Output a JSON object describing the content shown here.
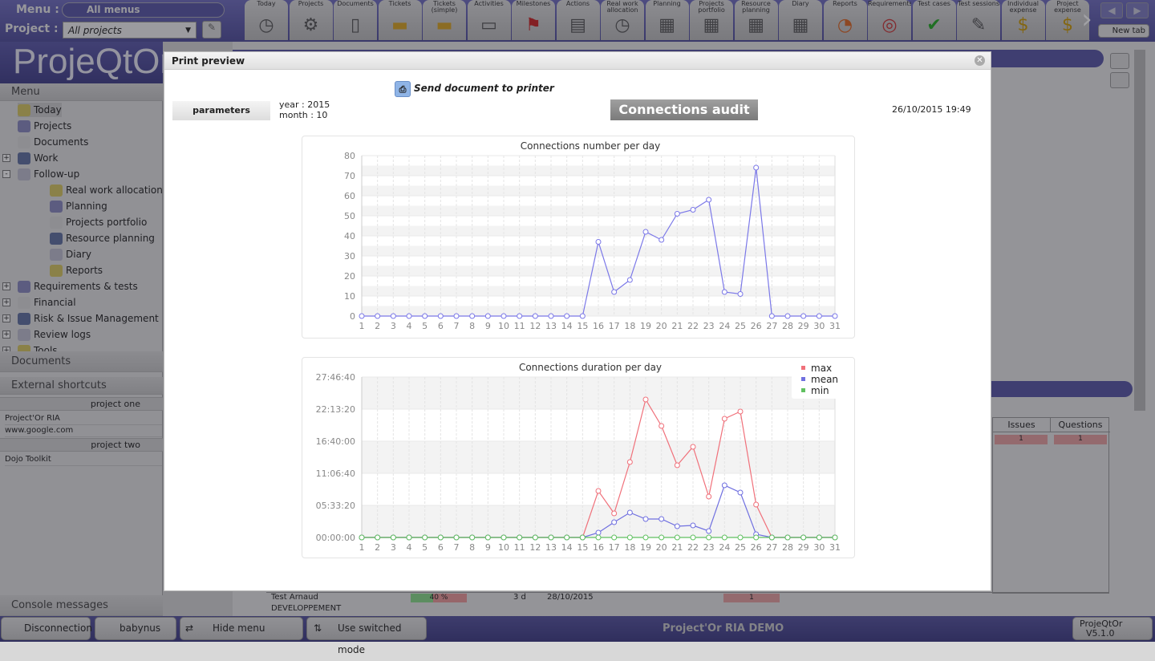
{
  "header": {
    "menu_label": "Menu :",
    "menu_value": "All menus",
    "project_label": "Project :",
    "project_value": "All projects",
    "logo": "ProjeQtOr",
    "toolbar": [
      {
        "label": "Today",
        "icon": "clock-icon"
      },
      {
        "label": "Projects",
        "icon": "gear-icon"
      },
      {
        "label": "Documents",
        "icon": "document-icon"
      },
      {
        "label": "Tickets",
        "icon": "ticket-icon"
      },
      {
        "label": "Tickets (simple)",
        "icon": "ticket-simple-icon"
      },
      {
        "label": "Activities",
        "icon": "computer-icon"
      },
      {
        "label": "Milestones",
        "icon": "flag-icon"
      },
      {
        "label": "Actions",
        "icon": "clapper-icon"
      },
      {
        "label": "Real work allocation",
        "icon": "work-allocation-icon"
      },
      {
        "label": "Planning",
        "icon": "gantt-icon"
      },
      {
        "label": "Projects portfolio",
        "icon": "portfolio-icon"
      },
      {
        "label": "Resource planning",
        "icon": "resource-planning-icon"
      },
      {
        "label": "Diary",
        "icon": "diary-icon"
      },
      {
        "label": "Reports",
        "icon": "reports-icon"
      },
      {
        "label": "Requirements",
        "icon": "target-icon"
      },
      {
        "label": "Test cases",
        "icon": "check-icon"
      },
      {
        "label": "Test sessions",
        "icon": "test-session-icon"
      },
      {
        "label": "Individual expense",
        "icon": "money-bag-icon"
      },
      {
        "label": "Project expense",
        "icon": "project-expense-icon"
      }
    ],
    "new_tab": "New tab"
  },
  "sidebar": {
    "menu_title": "Menu",
    "items": [
      {
        "label": "Today",
        "level": 0
      },
      {
        "label": "Projects",
        "level": 0
      },
      {
        "label": "Documents",
        "level": 0
      },
      {
        "label": "Work",
        "level": 0,
        "toggle": "+"
      },
      {
        "label": "Follow-up",
        "level": 0,
        "toggle": "-"
      },
      {
        "label": "Real work allocation",
        "level": 1
      },
      {
        "label": "Planning",
        "level": 1
      },
      {
        "label": "Projects portfolio",
        "level": 1
      },
      {
        "label": "Resource planning",
        "level": 1
      },
      {
        "label": "Diary",
        "level": 1
      },
      {
        "label": "Reports",
        "level": 1
      },
      {
        "label": "Requirements & tests",
        "level": 0,
        "toggle": "+"
      },
      {
        "label": "Financial",
        "level": 0,
        "toggle": "+"
      },
      {
        "label": "Risk & Issue Management",
        "level": 0,
        "toggle": "+"
      },
      {
        "label": "Review logs",
        "level": 0,
        "toggle": "+"
      },
      {
        "label": "Tools",
        "level": 0,
        "toggle": "+"
      }
    ],
    "documents_title": "Documents",
    "shortcuts_title": "External shortcuts",
    "shortcuts": [
      {
        "group": "project one",
        "links": [
          "Project'Or RIA",
          "www.google.com"
        ]
      },
      {
        "group": "project two",
        "links": [
          "Dojo Toolkit"
        ]
      }
    ],
    "console_title": "Console messages"
  },
  "main": {
    "table_headers": [
      "Issues",
      "Questions"
    ],
    "row_values": [
      "1",
      "1"
    ],
    "bottom_row": {
      "name": "Test Arnaud",
      "progress": "40 %",
      "duration": "3 d",
      "date": "28/10/2015",
      "count": "1"
    },
    "bottom_row2": "DEVELOPPEMENT"
  },
  "footer": {
    "disconnect": "Disconnection",
    "user": "babynus",
    "hide_menu": "Hide menu",
    "switched": "Use switched mode",
    "app_name": "Project'Or RIA DEMO",
    "version_name": "ProjeQtOr",
    "version": "V5.1.0"
  },
  "modal": {
    "title": "Print preview",
    "print_label": "Send document to printer",
    "params_button": "parameters",
    "param_year": "year : 2015",
    "param_month": "month : 10",
    "report_title": "Connections audit",
    "datetime": "26/10/2015 19:49"
  },
  "colors": {
    "max": "#f0707a",
    "mean": "#7070e0",
    "min": "#60c060",
    "count": "#7b78e8"
  },
  "chart_data": [
    {
      "type": "line",
      "title": "Connections number per day",
      "x": [
        1,
        2,
        3,
        4,
        5,
        6,
        7,
        8,
        9,
        10,
        11,
        12,
        13,
        14,
        15,
        16,
        17,
        18,
        19,
        20,
        21,
        22,
        23,
        24,
        25,
        26,
        27,
        28,
        29,
        30,
        31
      ],
      "ylim": [
        0,
        80
      ],
      "yticks": [
        0,
        10,
        20,
        30,
        40,
        50,
        60,
        70,
        80
      ],
      "grid": true,
      "series": [
        {
          "values": [
            0,
            0,
            0,
            0,
            0,
            0,
            0,
            0,
            0,
            0,
            0,
            0,
            0,
            0,
            0,
            37,
            12,
            18,
            42,
            38,
            51,
            53,
            58,
            12,
            11,
            74,
            0,
            0,
            0,
            0,
            0
          ]
        }
      ]
    },
    {
      "type": "line",
      "title": "Connections duration per day",
      "x": [
        1,
        2,
        3,
        4,
        5,
        6,
        7,
        8,
        9,
        10,
        11,
        12,
        13,
        14,
        15,
        16,
        17,
        18,
        19,
        20,
        21,
        22,
        23,
        24,
        25,
        26,
        27,
        28,
        29,
        30,
        31
      ],
      "ylim": [
        "00:00:00",
        "27:46:40"
      ],
      "yticks": [
        "00:00:00",
        "05:33:20",
        "11:06:40",
        "16:40:00",
        "22:13:20",
        "27:46:40"
      ],
      "grid": true,
      "legend": "top-right",
      "series": [
        {
          "name": "max",
          "values": [
            "00:00:00",
            "00:00:00",
            "00:00:00",
            "00:00:00",
            "00:00:00",
            "00:00:00",
            "00:00:00",
            "00:00:00",
            "00:00:00",
            "00:00:00",
            "00:00:00",
            "00:00:00",
            "00:00:00",
            "00:00:00",
            "00:00:00",
            "08:03:20",
            "04:10:00",
            "13:03:20",
            "23:53:20",
            "19:18:20",
            "12:30:00",
            "15:41:40",
            "07:05:00",
            "20:33:20",
            "21:48:20",
            "05:41:40",
            "00:00:00",
            "00:00:00",
            "00:00:00",
            "00:00:00",
            "00:00:00"
          ]
        },
        {
          "name": "mean",
          "values": [
            "00:00:00",
            "00:00:00",
            "00:00:00",
            "00:00:00",
            "00:00:00",
            "00:00:00",
            "00:00:00",
            "00:00:00",
            "00:00:00",
            "00:00:00",
            "00:00:00",
            "00:00:00",
            "00:00:00",
            "00:00:00",
            "00:00:00",
            "00:50:00",
            "02:38:20",
            "04:18:20",
            "03:11:40",
            "03:11:40",
            "01:56:40",
            "02:05:00",
            "01:06:40",
            "09:01:40",
            "07:46:40",
            "00:33:20",
            "00:00:00",
            "00:00:00",
            "00:00:00",
            "00:00:00",
            "00:00:00"
          ]
        },
        {
          "name": "min",
          "values": [
            "00:00:00",
            "00:00:00",
            "00:00:00",
            "00:00:00",
            "00:00:00",
            "00:00:00",
            "00:00:00",
            "00:00:00",
            "00:00:00",
            "00:00:00",
            "00:00:00",
            "00:00:00",
            "00:00:00",
            "00:00:00",
            "00:00:00",
            "00:00:00",
            "00:00:00",
            "00:00:00",
            "00:00:00",
            "00:00:00",
            "00:00:00",
            "00:00:00",
            "00:00:00",
            "00:00:00",
            "00:00:00",
            "00:00:00",
            "00:00:00",
            "00:00:00",
            "00:00:00",
            "00:00:00",
            "00:00:00"
          ]
        }
      ]
    }
  ]
}
